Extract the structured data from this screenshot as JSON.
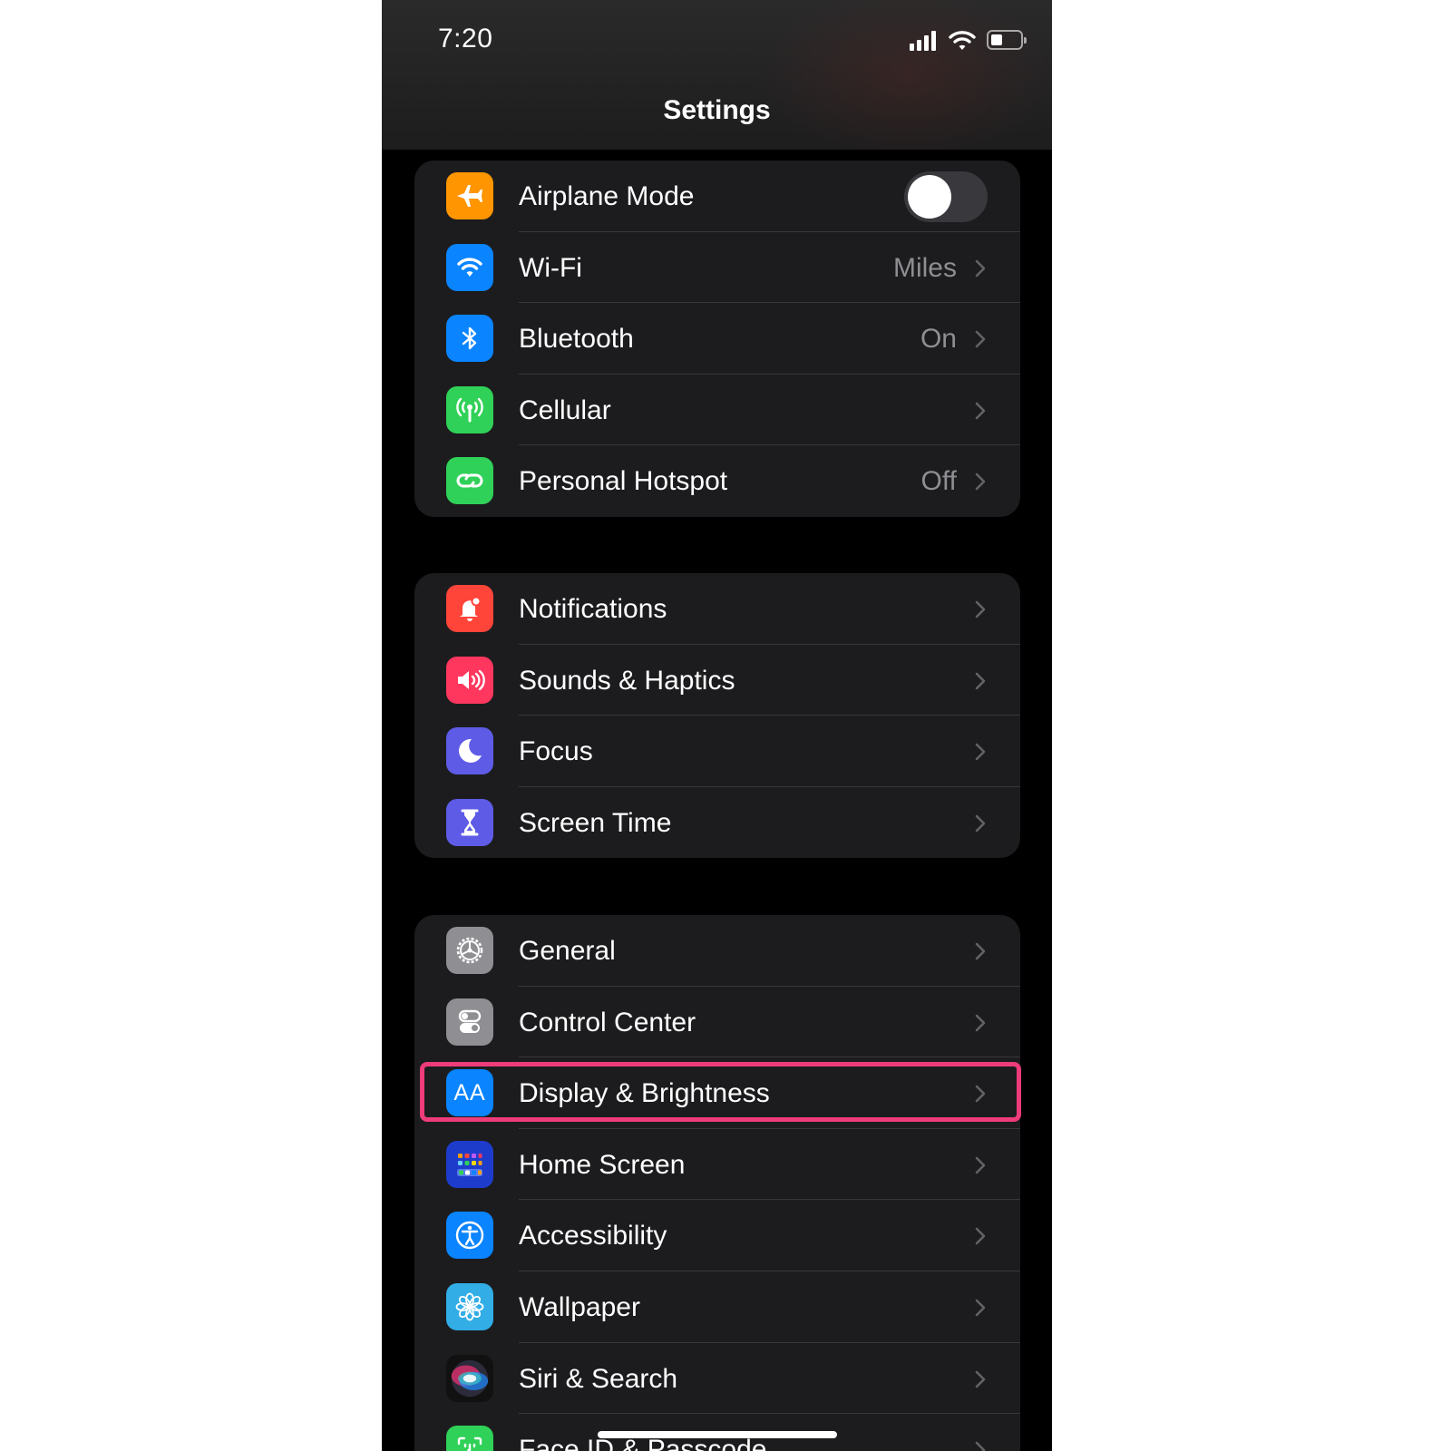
{
  "status_bar": {
    "time": "7:20"
  },
  "nav": {
    "title": "Settings"
  },
  "colors": {
    "background": "#000000",
    "group_background": "#1c1c1e",
    "highlight": "#ee3c7a",
    "secondary_text": "#8e8e93"
  },
  "groups": [
    {
      "items": [
        {
          "label": "Airplane Mode",
          "icon": "airplane-icon",
          "icon_color": "#ff9500",
          "toggle": "off"
        },
        {
          "label": "Wi-Fi",
          "icon": "wifi-icon",
          "icon_color": "#0a84ff",
          "value": "Miles"
        },
        {
          "label": "Bluetooth",
          "icon": "bluetooth-icon",
          "icon_color": "#0a84ff",
          "value": "On"
        },
        {
          "label": "Cellular",
          "icon": "antenna-icon",
          "icon_color": "#30d158",
          "value": ""
        },
        {
          "label": "Personal Hotspot",
          "icon": "hotspot-link-icon",
          "icon_color": "#30d158",
          "value": "Off"
        }
      ]
    },
    {
      "items": [
        {
          "label": "Notifications",
          "icon": "bell-icon",
          "icon_color": "#ff453a"
        },
        {
          "label": "Sounds & Haptics",
          "icon": "speaker-icon",
          "icon_color": "#ff375f"
        },
        {
          "label": "Focus",
          "icon": "moon-icon",
          "icon_color": "#5e5ce6"
        },
        {
          "label": "Screen Time",
          "icon": "hourglass-icon",
          "icon_color": "#5e5ce6"
        }
      ]
    },
    {
      "items": [
        {
          "label": "General",
          "icon": "gear-icon",
          "icon_color": "#8e8e93"
        },
        {
          "label": "Control Center",
          "icon": "switches-icon",
          "icon_color": "#8e8e93"
        },
        {
          "label": "Display & Brightness",
          "icon": "text-size-icon",
          "icon_color": "#0a84ff",
          "icon_text": "AA",
          "highlighted": true
        },
        {
          "label": "Home Screen",
          "icon": "app-grid-icon",
          "icon_color": "#1e3ccc"
        },
        {
          "label": "Accessibility",
          "icon": "accessibility-icon",
          "icon_color": "#0a84ff"
        },
        {
          "label": "Wallpaper",
          "icon": "flower-icon",
          "icon_color": "#32ade6"
        },
        {
          "label": "Siri & Search",
          "icon": "siri-icon",
          "icon_color": "#1c1c1e"
        },
        {
          "label": "Face ID & Passcode",
          "icon": "face-id-icon",
          "icon_color": "#30d158"
        }
      ]
    }
  ]
}
